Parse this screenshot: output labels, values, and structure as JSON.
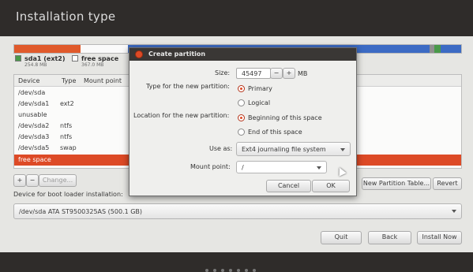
{
  "window": {
    "title": "Installation type"
  },
  "partition_bar": {
    "colors": {
      "sda1": "#e05a2b",
      "free": "#ffffff",
      "blue": "#3c6bc4",
      "gray": "#8f8f8f",
      "green": "#4a9a4a",
      "bg": "#d9d9d9"
    }
  },
  "legend": [
    {
      "name": "sda1 (ext2)",
      "size": "254.8 MB",
      "color": "#4a9a4a"
    },
    {
      "name": "free space",
      "size": "367.0 MB",
      "color": "#ffffff"
    }
  ],
  "table": {
    "headers": {
      "device": "Device",
      "type": "Type",
      "mount": "Mount point"
    },
    "rows": [
      {
        "device": "/dev/sda",
        "type": ""
      },
      {
        "device": "/dev/sda1",
        "type": "ext2"
      },
      {
        "device": "unusable",
        "type": ""
      },
      {
        "device": "/dev/sda2",
        "type": "ntfs"
      },
      {
        "device": "/dev/sda3",
        "type": "ntfs"
      },
      {
        "device": "/dev/sda5",
        "type": "swap"
      },
      {
        "device": "free space",
        "type": ""
      }
    ]
  },
  "controls": {
    "add": "+",
    "remove": "−",
    "change": "Change...",
    "new_partition_table": "New Partition Table...",
    "revert": "Revert",
    "boot_loader_label": "Device for boot loader installation:",
    "boot_loader_device": "/dev/sda   ATA ST9500325AS (500.1 GB)",
    "quit": "Quit",
    "back": "Back",
    "install_now": "Install Now"
  },
  "dialog": {
    "title": "Create partition",
    "size_label": "Size:",
    "size_value": "45497",
    "size_minus": "−",
    "size_plus": "+",
    "size_unit": "MB",
    "type_label": "Type for the new partition:",
    "type_primary": "Primary",
    "type_logical": "Logical",
    "location_label": "Location for the new partition:",
    "location_beginning": "Beginning of this space",
    "location_end": "End of this space",
    "use_as_label": "Use as:",
    "use_as_value": "Ext4 journaling file system",
    "mount_label": "Mount point:",
    "mount_value": "/",
    "cancel": "Cancel",
    "ok": "OK"
  }
}
